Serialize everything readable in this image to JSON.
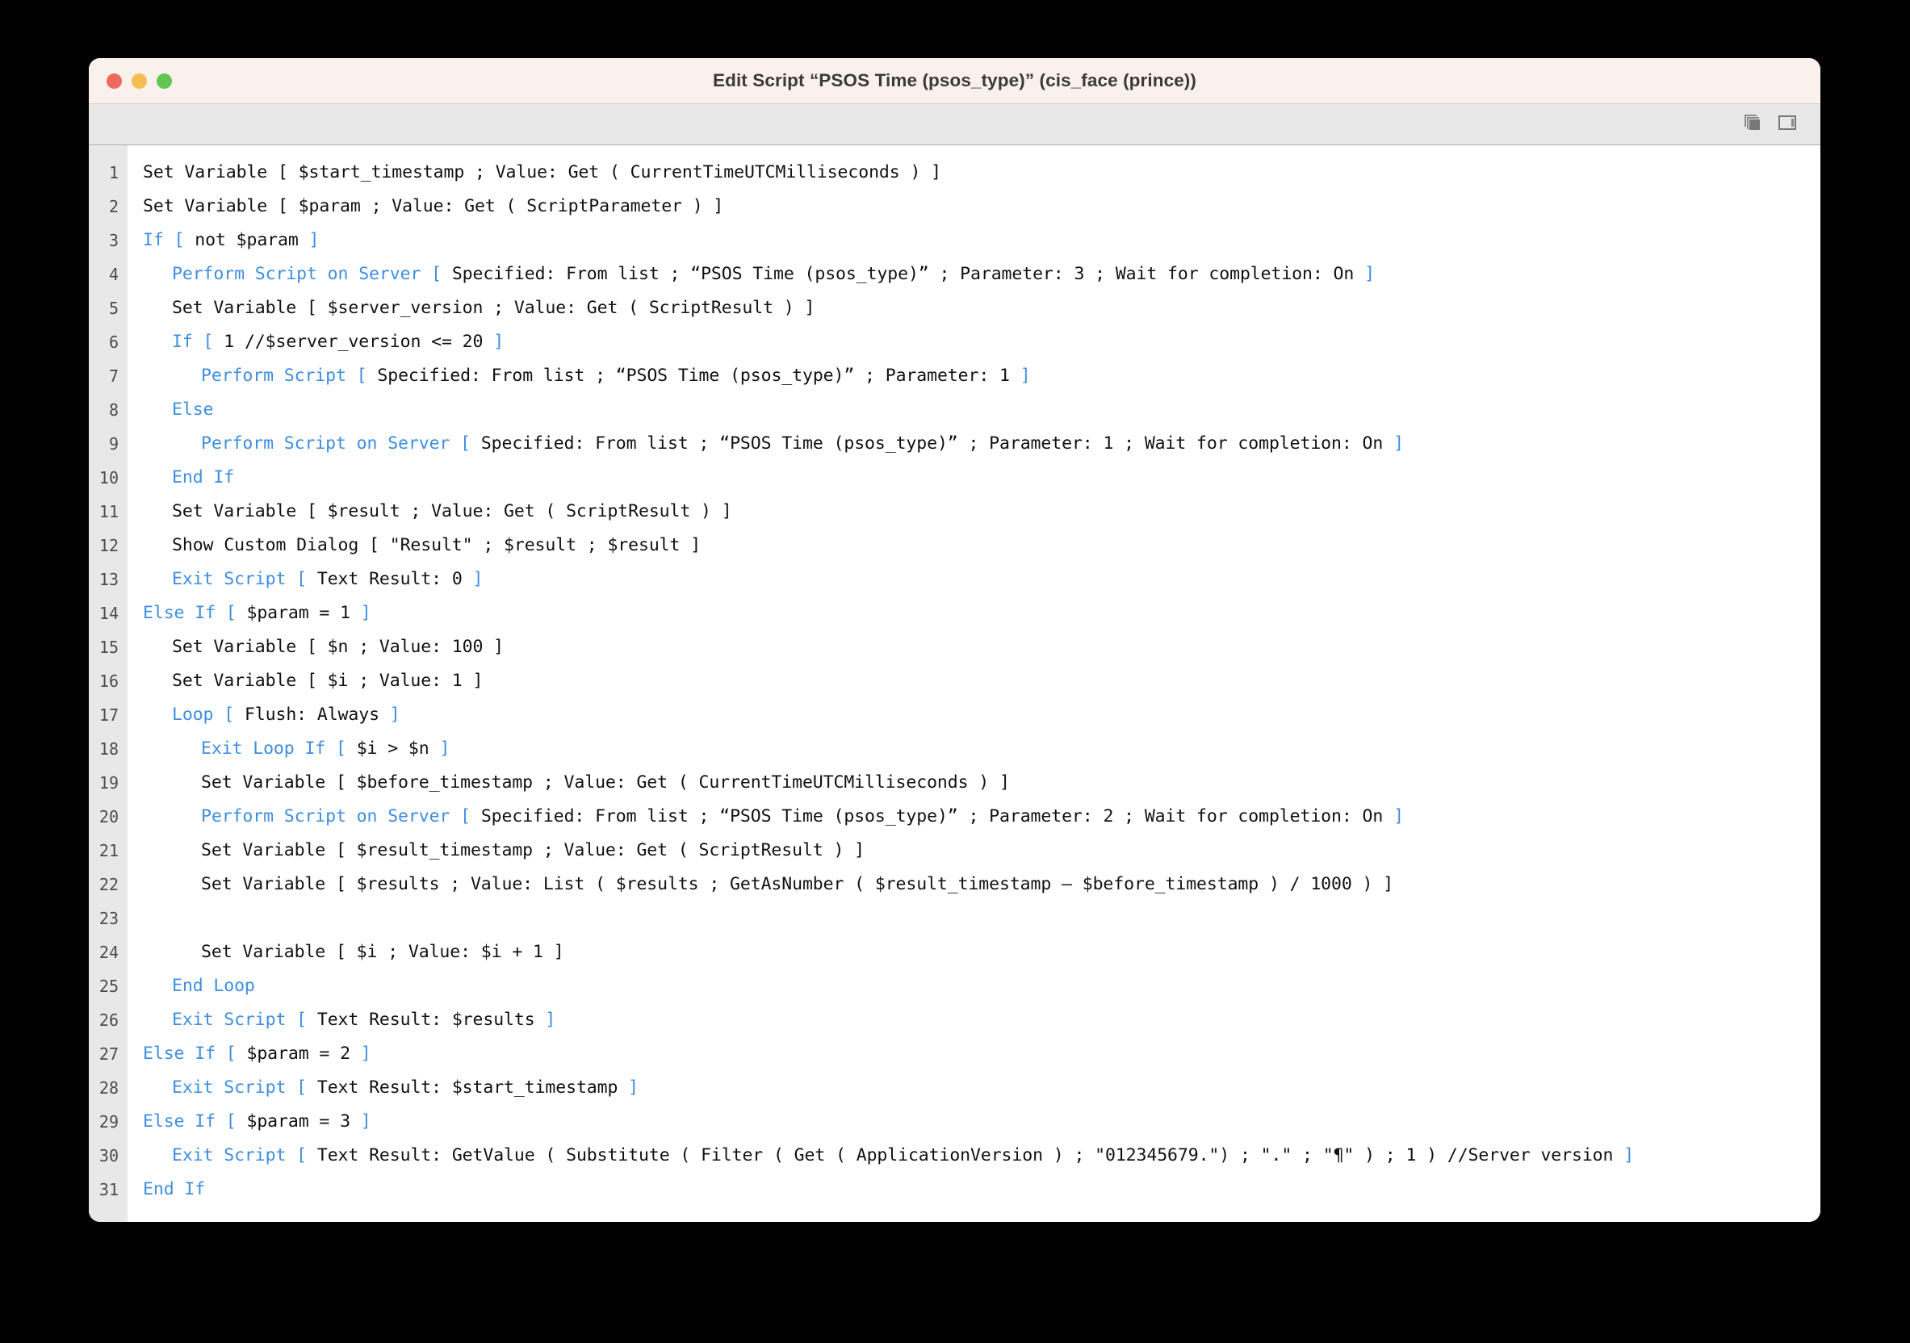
{
  "window": {
    "title": "Edit Script “PSOS Time (psos_type)” (cis_face (prince))",
    "traffic_lights": {
      "close": "close-button",
      "minimize": "minimize-button",
      "zoom": "zoom-button",
      "close_color": "#ED6A5E",
      "minimize_color": "#F5BD4F",
      "zoom_color": "#62C554"
    },
    "titlebar_color": "#FAF1EC",
    "toolbar_color": "#E8E8E8"
  },
  "toolbar": {
    "buttons": [
      {
        "name": "duplicate-window-icon",
        "label": ""
      },
      {
        "name": "sidebar-panel-icon",
        "label": ""
      }
    ]
  },
  "editor": {
    "gutter_color": "#E8E8E8",
    "keyword_color": "#3E8EE0",
    "text_color": "#111111",
    "line_numbers": [
      1,
      2,
      3,
      4,
      5,
      6,
      7,
      8,
      9,
      10,
      11,
      12,
      13,
      14,
      15,
      16,
      17,
      18,
      19,
      20,
      21,
      22,
      23,
      24,
      25,
      26,
      27,
      28,
      29,
      30,
      31
    ],
    "lines": [
      {
        "n": 1,
        "indent": 0,
        "tokens": [
          {
            "t": "text",
            "v": "Set Variable [ $start_timestamp ; Value: Get ( CurrentTimeUTCMilliseconds ) ]"
          }
        ]
      },
      {
        "n": 2,
        "indent": 0,
        "tokens": [
          {
            "t": "text",
            "v": "Set Variable [ $param ; Value: Get ( ScriptParameter ) ]"
          }
        ]
      },
      {
        "n": 3,
        "indent": 0,
        "tokens": [
          {
            "t": "kw",
            "v": "If "
          },
          {
            "t": "br",
            "v": "["
          },
          {
            "t": "text",
            "v": " not $param "
          },
          {
            "t": "br",
            "v": "]"
          }
        ]
      },
      {
        "n": 4,
        "indent": 1,
        "tokens": [
          {
            "t": "kw",
            "v": "Perform Script on Server "
          },
          {
            "t": "br",
            "v": "["
          },
          {
            "t": "text",
            "v": " Specified: From list ; “PSOS Time (psos_type)” ; Parameter: 3 ; Wait for completion: On "
          },
          {
            "t": "br",
            "v": "]"
          }
        ]
      },
      {
        "n": 5,
        "indent": 1,
        "tokens": [
          {
            "t": "text",
            "v": "Set Variable [ $server_version ; Value: Get ( ScriptResult ) ]"
          }
        ]
      },
      {
        "n": 6,
        "indent": 1,
        "tokens": [
          {
            "t": "kw",
            "v": "If "
          },
          {
            "t": "br",
            "v": "["
          },
          {
            "t": "text",
            "v": " 1 //$server_version <= 20 "
          },
          {
            "t": "br",
            "v": "]"
          }
        ]
      },
      {
        "n": 7,
        "indent": 2,
        "tokens": [
          {
            "t": "kw",
            "v": "Perform Script "
          },
          {
            "t": "br",
            "v": "["
          },
          {
            "t": "text",
            "v": " Specified: From list ; “PSOS Time (psos_type)” ; Parameter: 1 "
          },
          {
            "t": "br",
            "v": "]"
          }
        ]
      },
      {
        "n": 8,
        "indent": 1,
        "tokens": [
          {
            "t": "kw",
            "v": "Else"
          }
        ]
      },
      {
        "n": 9,
        "indent": 2,
        "tokens": [
          {
            "t": "kw",
            "v": "Perform Script on Server "
          },
          {
            "t": "br",
            "v": "["
          },
          {
            "t": "text",
            "v": " Specified: From list ; “PSOS Time (psos_type)” ; Parameter: 1 ; Wait for completion: On "
          },
          {
            "t": "br",
            "v": "]"
          }
        ]
      },
      {
        "n": 10,
        "indent": 1,
        "tokens": [
          {
            "t": "kw",
            "v": "End If"
          }
        ]
      },
      {
        "n": 11,
        "indent": 1,
        "tokens": [
          {
            "t": "text",
            "v": "Set Variable [ $result ; Value: Get ( ScriptResult ) ]"
          }
        ]
      },
      {
        "n": 12,
        "indent": 1,
        "tokens": [
          {
            "t": "text",
            "v": "Show Custom Dialog [ \"Result\" ; $result ; $result ]"
          }
        ]
      },
      {
        "n": 13,
        "indent": 1,
        "tokens": [
          {
            "t": "kw",
            "v": "Exit Script "
          },
          {
            "t": "br",
            "v": "["
          },
          {
            "t": "text",
            "v": " Text Result: 0 "
          },
          {
            "t": "br",
            "v": "]"
          }
        ]
      },
      {
        "n": 14,
        "indent": 0,
        "tokens": [
          {
            "t": "kw",
            "v": "Else If "
          },
          {
            "t": "br",
            "v": "["
          },
          {
            "t": "text",
            "v": " $param = 1 "
          },
          {
            "t": "br",
            "v": "]"
          }
        ]
      },
      {
        "n": 15,
        "indent": 1,
        "tokens": [
          {
            "t": "text",
            "v": "Set Variable [ $n ; Value: 100 ]"
          }
        ]
      },
      {
        "n": 16,
        "indent": 1,
        "tokens": [
          {
            "t": "text",
            "v": "Set Variable [ $i ; Value: 1 ]"
          }
        ]
      },
      {
        "n": 17,
        "indent": 1,
        "tokens": [
          {
            "t": "kw",
            "v": "Loop "
          },
          {
            "t": "br",
            "v": "["
          },
          {
            "t": "text",
            "v": " Flush: Always "
          },
          {
            "t": "br",
            "v": "]"
          }
        ]
      },
      {
        "n": 18,
        "indent": 2,
        "tokens": [
          {
            "t": "kw",
            "v": "Exit Loop If "
          },
          {
            "t": "br",
            "v": "["
          },
          {
            "t": "text",
            "v": " $i > $n "
          },
          {
            "t": "br",
            "v": "]"
          }
        ]
      },
      {
        "n": 19,
        "indent": 2,
        "tokens": [
          {
            "t": "text",
            "v": "Set Variable [ $before_timestamp ; Value: Get ( CurrentTimeUTCMilliseconds ) ]"
          }
        ]
      },
      {
        "n": 20,
        "indent": 2,
        "tokens": [
          {
            "t": "kw",
            "v": "Perform Script on Server "
          },
          {
            "t": "br",
            "v": "["
          },
          {
            "t": "text",
            "v": " Specified: From list ; “PSOS Time (psos_type)” ; Parameter: 2 ; Wait for completion: On "
          },
          {
            "t": "br",
            "v": "]"
          }
        ]
      },
      {
        "n": 21,
        "indent": 2,
        "tokens": [
          {
            "t": "text",
            "v": "Set Variable [ $result_timestamp ; Value: Get ( ScriptResult ) ]"
          }
        ]
      },
      {
        "n": 22,
        "indent": 2,
        "tokens": [
          {
            "t": "text",
            "v": "Set Variable [ $results ; Value: List ( $results ; GetAsNumber ( $result_timestamp – $before_timestamp ) / 1000 ) ]"
          }
        ]
      },
      {
        "n": 23,
        "indent": 0,
        "tokens": []
      },
      {
        "n": 24,
        "indent": 2,
        "tokens": [
          {
            "t": "text",
            "v": "Set Variable [ $i ; Value: $i + 1 ]"
          }
        ]
      },
      {
        "n": 25,
        "indent": 1,
        "tokens": [
          {
            "t": "kw",
            "v": "End Loop"
          }
        ]
      },
      {
        "n": 26,
        "indent": 1,
        "tokens": [
          {
            "t": "kw",
            "v": "Exit Script "
          },
          {
            "t": "br",
            "v": "["
          },
          {
            "t": "text",
            "v": " Text Result: $results "
          },
          {
            "t": "br",
            "v": "]"
          }
        ]
      },
      {
        "n": 27,
        "indent": 0,
        "tokens": [
          {
            "t": "kw",
            "v": "Else If "
          },
          {
            "t": "br",
            "v": "["
          },
          {
            "t": "text",
            "v": " $param = 2 "
          },
          {
            "t": "br",
            "v": "]"
          }
        ]
      },
      {
        "n": 28,
        "indent": 1,
        "tokens": [
          {
            "t": "kw",
            "v": "Exit Script "
          },
          {
            "t": "br",
            "v": "["
          },
          {
            "t": "text",
            "v": " Text Result: $start_timestamp "
          },
          {
            "t": "br",
            "v": "]"
          }
        ]
      },
      {
        "n": 29,
        "indent": 0,
        "tokens": [
          {
            "t": "kw",
            "v": "Else If "
          },
          {
            "t": "br",
            "v": "["
          },
          {
            "t": "text",
            "v": " $param = 3 "
          },
          {
            "t": "br",
            "v": "]"
          }
        ]
      },
      {
        "n": 30,
        "indent": 1,
        "tokens": [
          {
            "t": "kw",
            "v": "Exit Script "
          },
          {
            "t": "br",
            "v": "["
          },
          {
            "t": "text",
            "v": " Text Result: GetValue ( Substitute ( Filter ( Get ( ApplicationVersion ) ; \"012345679.\") ; \".\" ; \"¶\" ) ; 1 ) //Server version "
          },
          {
            "t": "br",
            "v": "]"
          }
        ]
      },
      {
        "n": 31,
        "indent": 0,
        "tokens": [
          {
            "t": "kw",
            "v": "End If"
          }
        ]
      }
    ]
  }
}
